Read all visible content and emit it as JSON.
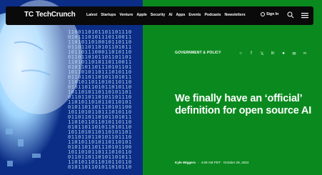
{
  "header": {
    "logo_mark": "TC",
    "logo_text": "TechCrunch",
    "nav": [
      "Latest",
      "Startups",
      "Venture",
      "Apple",
      "Security",
      "AI",
      "Apps",
      "Events",
      "Podcasts",
      "Newsletters"
    ],
    "signin_label": "Sign In"
  },
  "article": {
    "category": "GOVERNMENT & POLICY",
    "title": "We finally have an ‘official’ definition for open source AI",
    "author": "Kyle Wiggers",
    "separator": "-",
    "timestamp": "4:59 AM PDT · October 28, 2024"
  },
  "share_icons": [
    "comment-icon",
    "facebook-icon",
    "x-icon",
    "linkedin-icon",
    "reddit-icon",
    "email-icon",
    "link-icon"
  ],
  "colors": {
    "nav_background": "#0a0a0a",
    "hero_green": "#0a8a1e",
    "hero_blue": "#0b2d86",
    "text": "#ffffff"
  }
}
